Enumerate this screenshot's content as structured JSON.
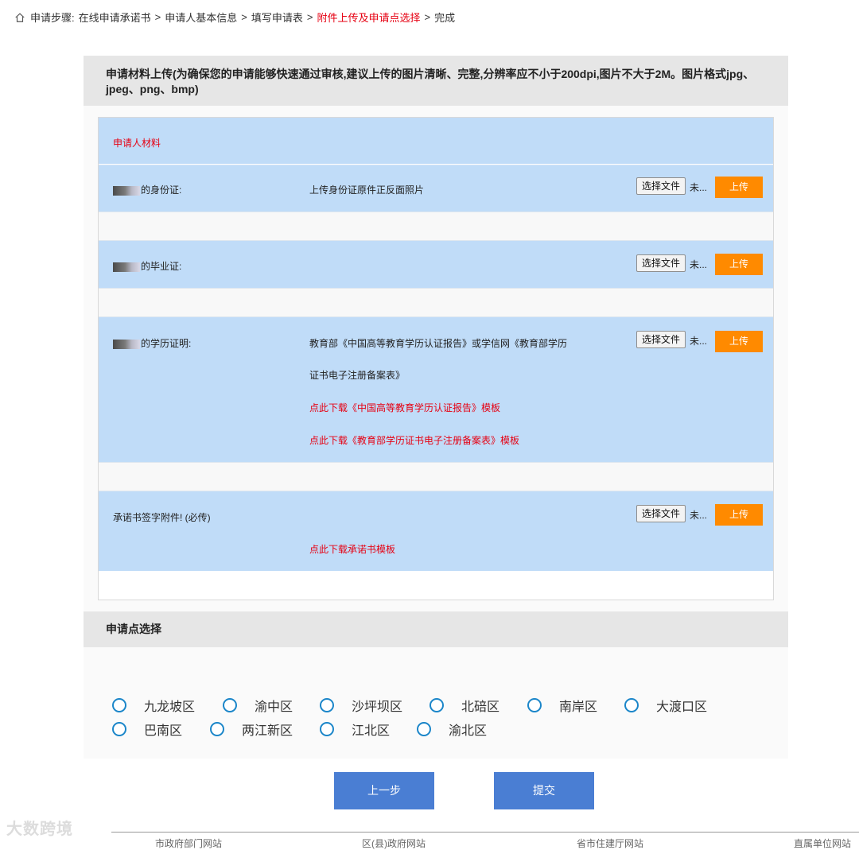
{
  "breadcrumb": {
    "prefix": "申请步骤:",
    "steps": [
      "在线申请承诺书",
      "申请人基本信息",
      "填写申请表",
      "附件上传及申请点选择",
      "完成"
    ],
    "separator": ">",
    "active_index": 3
  },
  "upload": {
    "header": "申请材料上传(为确保您的申请能够快速通过审核,建议上传的图片清晰、完整,分辨率应不小于200dpi,图片不大于2M。图片格式jpg、jpeg、png、bmp)",
    "group_title": "申请人材料",
    "choose_file_label": "选择文件",
    "no_file_text": "未...",
    "upload_label": "上传",
    "items": [
      {
        "label": "的身份证:",
        "desc": [
          "上传身份证原件正反面照片"
        ]
      },
      {
        "label": "的毕业证:",
        "desc": []
      },
      {
        "label": "的学历证明:",
        "desc": [
          "教育部《中国高等教育学历认证报告》或学信网《教育部学历",
          "证书电子注册备案表》"
        ],
        "links": [
          "点此下载《中国高等教育学历认证报告》模板",
          "点此下载《教育部学历证书电子注册备案表》模板"
        ]
      },
      {
        "label": "承诺书签字附件! (必传)",
        "links": [
          "点此下载承诺书模板"
        ]
      }
    ]
  },
  "point_selection": {
    "header": "申请点选择",
    "options": [
      "九龙坡区",
      "渝中区",
      "沙坪坝区",
      "北碚区",
      "南岸区",
      "大渡口区",
      "巴南区",
      "两江新区",
      "江北区",
      "渝北区"
    ]
  },
  "buttons": {
    "prev": "上一步",
    "submit": "提交"
  },
  "footer": {
    "links": [
      "市政府部门网站",
      "区(县)政府网站",
      "省市住建厅网站",
      "直属单位网站"
    ]
  },
  "watermark": "大数跨境",
  "colors": {
    "accent_red": "#e60012",
    "row_blue": "#c0dcf8",
    "upload_orange": "#ff8a00",
    "button_blue": "#4a7ed3",
    "radio_blue": "#1b86c9"
  }
}
